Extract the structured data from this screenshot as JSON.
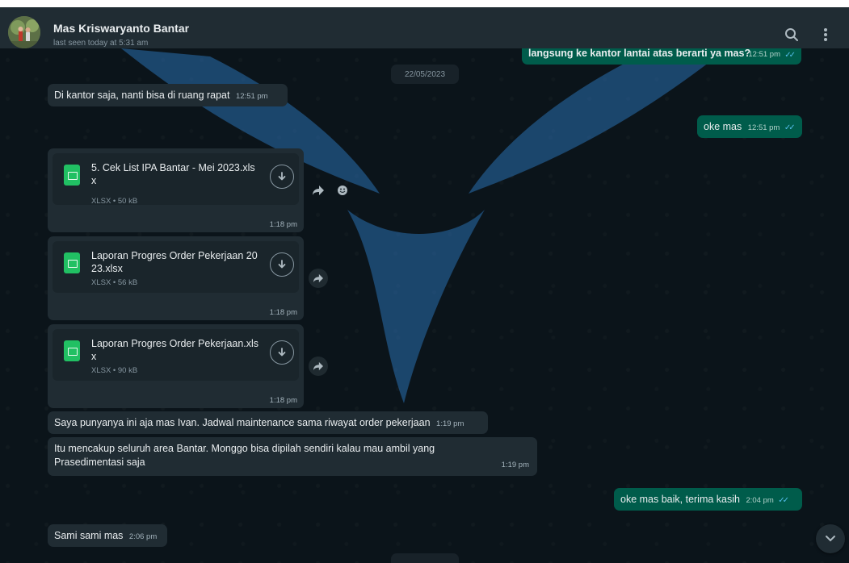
{
  "header": {
    "contact_name": "Mas Kriswaryanto Bantar",
    "last_seen": "last seen today at 5:31 am",
    "search_icon": "search-icon",
    "menu_icon": "kebab-menu-icon"
  },
  "chat": {
    "date_separator": "22/05/2023",
    "messages": [
      {
        "direction": "out",
        "text": "langsung ke kantor lantai atas berarti ya mas?",
        "time": "12:51 pm",
        "status": "read"
      },
      {
        "direction": "in",
        "text": "Di kantor saja, nanti bisa di ruang rapat",
        "time": "12:51 pm"
      },
      {
        "direction": "out",
        "text": "oke mas",
        "time": "12:51 pm",
        "status": "read"
      },
      {
        "direction": "in",
        "type": "file",
        "file_name": "5. Cek List IPA Bantar - Mei 2023.xlsx",
        "file_meta": "XLSX • 50 kB",
        "time": "1:18 pm"
      },
      {
        "direction": "in",
        "type": "file",
        "file_name": "Laporan Progres Order Pekerjaan 2023.xlsx",
        "file_meta": "XLSX • 56 kB",
        "time": "1:18 pm"
      },
      {
        "direction": "in",
        "type": "file",
        "file_name": "Laporan Progres Order Pekerjaan.xlsx",
        "file_meta": "XLSX • 90 kB",
        "time": "1:18 pm"
      },
      {
        "direction": "in",
        "text": "Saya punyanya ini aja mas Ivan. Jadwal maintenance sama riwayat order pekerjaan",
        "time": "1:19 pm"
      },
      {
        "direction": "in",
        "text": "Itu mencakup seluruh area Bantar. Monggo bisa dipilah sendiri kalau mau ambil yang Prasedimentasi saja",
        "time": "1:19 pm"
      },
      {
        "direction": "out",
        "text": "oke mas baik, terima kasih",
        "time": "2:04 pm",
        "status": "read"
      },
      {
        "direction": "in",
        "text": "Sami sami mas",
        "time": "2:06 pm"
      }
    ]
  },
  "colors": {
    "panel": "#202c33",
    "incoming": "#202c33",
    "outgoing": "#005c4b",
    "background": "#0b141a",
    "read_tick": "#53bdeb"
  }
}
